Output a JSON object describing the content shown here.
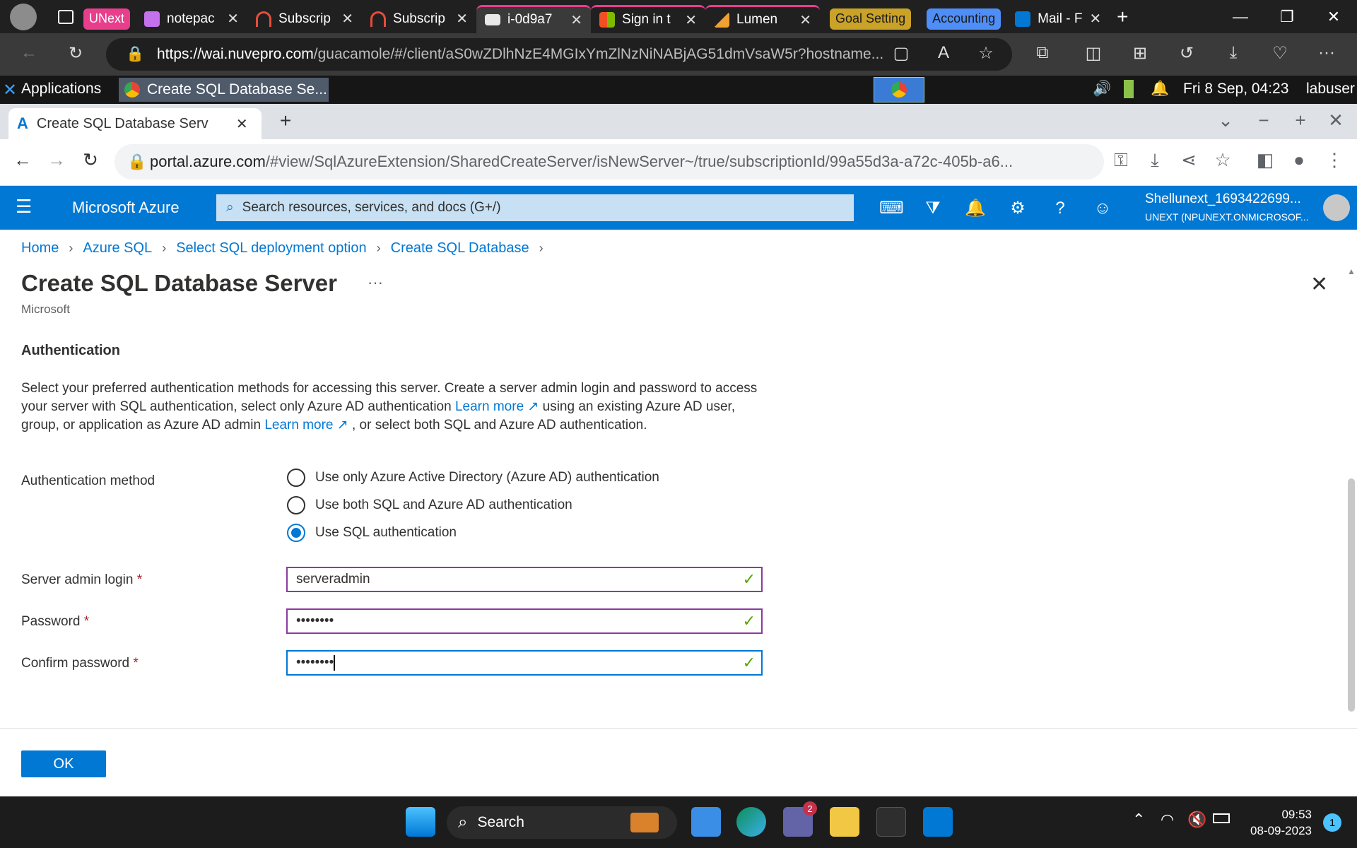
{
  "edge": {
    "tabs": [
      {
        "label": "notepac",
        "icon": "notepad-icon",
        "color": "#c471ed"
      },
      {
        "label": "Subscrip",
        "icon": "subscription-icon",
        "color": "#e74c3c"
      },
      {
        "label": "Subscrip",
        "icon": "subscription-icon",
        "color": "#e74c3c"
      },
      {
        "label": "i-0d9a7",
        "icon": "remote-desktop-icon",
        "color": "#ffffff"
      },
      {
        "label": "Sign in t",
        "icon": "microsoft-icon",
        "color": "#f25022"
      },
      {
        "label": "Lumen",
        "icon": "lumen-icon",
        "color": "#f0a030"
      },
      {
        "label": "Mail - F",
        "icon": "outlook-icon",
        "color": "#0078d4"
      }
    ],
    "groups": {
      "unext": "UNext",
      "goal": "Goal Setting",
      "accounting": "Accounting"
    },
    "url_host": "https://wai.nuvepro.com",
    "url_path": "/guacamole/#/client/aS0wZDlhNzE4MGIxYmZlNzNiNABjAG51dmVsaW5r?hostname..."
  },
  "xfce": {
    "applications": "Applications",
    "window_title": "Create SQL Database Se...",
    "datetime": "Fri  8 Sep, 04:23",
    "user": "labuser"
  },
  "chrome": {
    "tab_title": "Create SQL Database Serv",
    "url_host": "portal.azure.com",
    "url_path": "/#view/SqlAzureExtension/SharedCreateServer/isNewServer~/true/subscriptionId/99a55d3a-a72c-405b-a6..."
  },
  "azure": {
    "brand": "Microsoft Azure",
    "search_placeholder": "Search resources, services, and docs (G+/)",
    "account_name": "Shellunext_1693422699...",
    "account_tenant": "UNEXT (NPUNEXT.ONMICROSOF..."
  },
  "breadcrumb": [
    "Home",
    "Azure SQL",
    "Select SQL deployment option",
    "Create SQL Database"
  ],
  "page": {
    "title": "Create SQL Database Server",
    "more": "···",
    "subtitle": "Microsoft",
    "section": "Authentication",
    "desc_1": "Select your preferred authentication methods for accessing this server. Create a server admin login and password to access your server with SQL authentication, select only Azure AD authentication ",
    "learn_more_1": "Learn more",
    "desc_2": " using an existing Azure AD user, group, or application as Azure AD admin ",
    "learn_more_2": "Learn more",
    "desc_3": " , or select both SQL and Azure AD authentication."
  },
  "form": {
    "auth_label": "Authentication method",
    "auth_options": [
      {
        "label": "Use only Azure Active Directory (Azure AD) authentication",
        "selected": false
      },
      {
        "label": "Use both SQL and Azure AD authentication",
        "selected": false
      },
      {
        "label": "Use SQL authentication",
        "selected": true
      }
    ],
    "login_label": "Server admin login",
    "login_value": "serveradmin",
    "password_label": "Password",
    "password_value": "••••••••",
    "confirm_label": "Confirm password",
    "confirm_value": "••••••••",
    "required_mark": "*",
    "ok_label": "OK"
  },
  "taskbar": {
    "search_label": "Search",
    "teams_badge": "2",
    "time": "09:53",
    "date": "08-09-2023",
    "notifications": "1"
  }
}
